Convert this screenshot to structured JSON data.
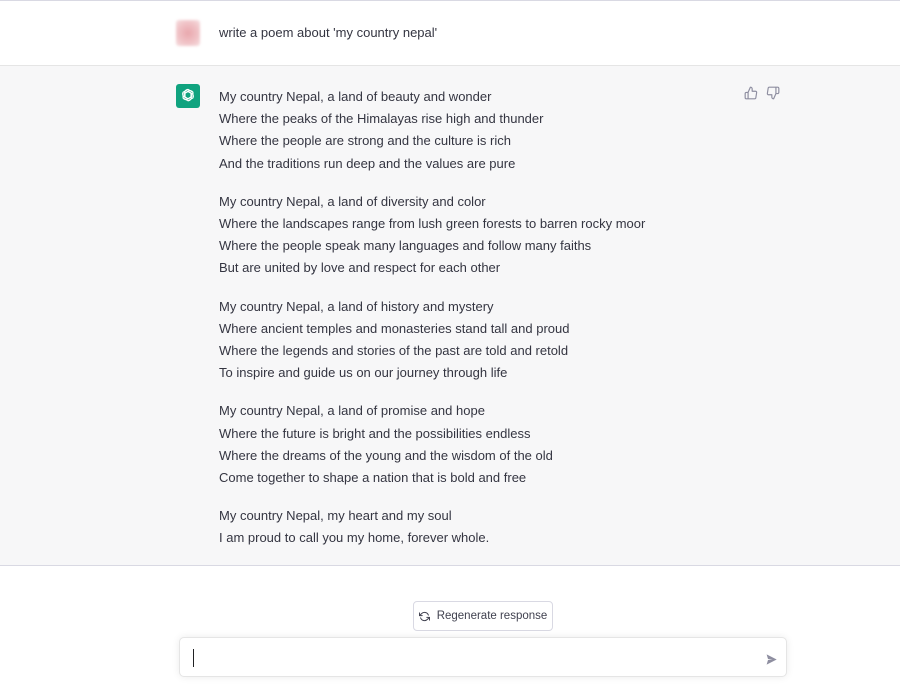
{
  "conversation": {
    "user_message": "write a poem about 'my country nepal'",
    "assistant_stanzas": [
      [
        "My country Nepal, a land of beauty and wonder",
        "Where the peaks of the Himalayas rise high and thunder",
        "Where the people are strong and the culture is rich",
        "And the traditions run deep and the values are pure"
      ],
      [
        "My country Nepal, a land of diversity and color",
        "Where the landscapes range from lush green forests to barren rocky moor",
        "Where the people speak many languages and follow many faiths",
        "But are united by love and respect for each other"
      ],
      [
        "My country Nepal, a land of history and mystery",
        "Where ancient temples and monasteries stand tall and proud",
        "Where the legends and stories of the past are told and retold",
        "To inspire and guide us on our journey through life"
      ],
      [
        "My country Nepal, a land of promise and hope",
        "Where the future is bright and the possibilities endless",
        "Where the dreams of the young and the wisdom of the old",
        "Come together to shape a nation that is bold and free"
      ],
      [
        "My country Nepal, my heart and my soul",
        "I am proud to call you my home, forever whole."
      ]
    ]
  },
  "actions": {
    "regenerate_label": "Regenerate response"
  },
  "composer": {
    "value": "",
    "placeholder": ""
  },
  "icons": {
    "assistant_avatar": "openai-logo-icon",
    "thumbs_up": "thumbs-up-icon",
    "thumbs_down": "thumbs-down-icon",
    "regenerate": "refresh-icon",
    "send": "send-icon"
  },
  "colors": {
    "brand_green": "#10a37f",
    "assistant_bg": "#f7f7f8",
    "text": "#343541"
  }
}
